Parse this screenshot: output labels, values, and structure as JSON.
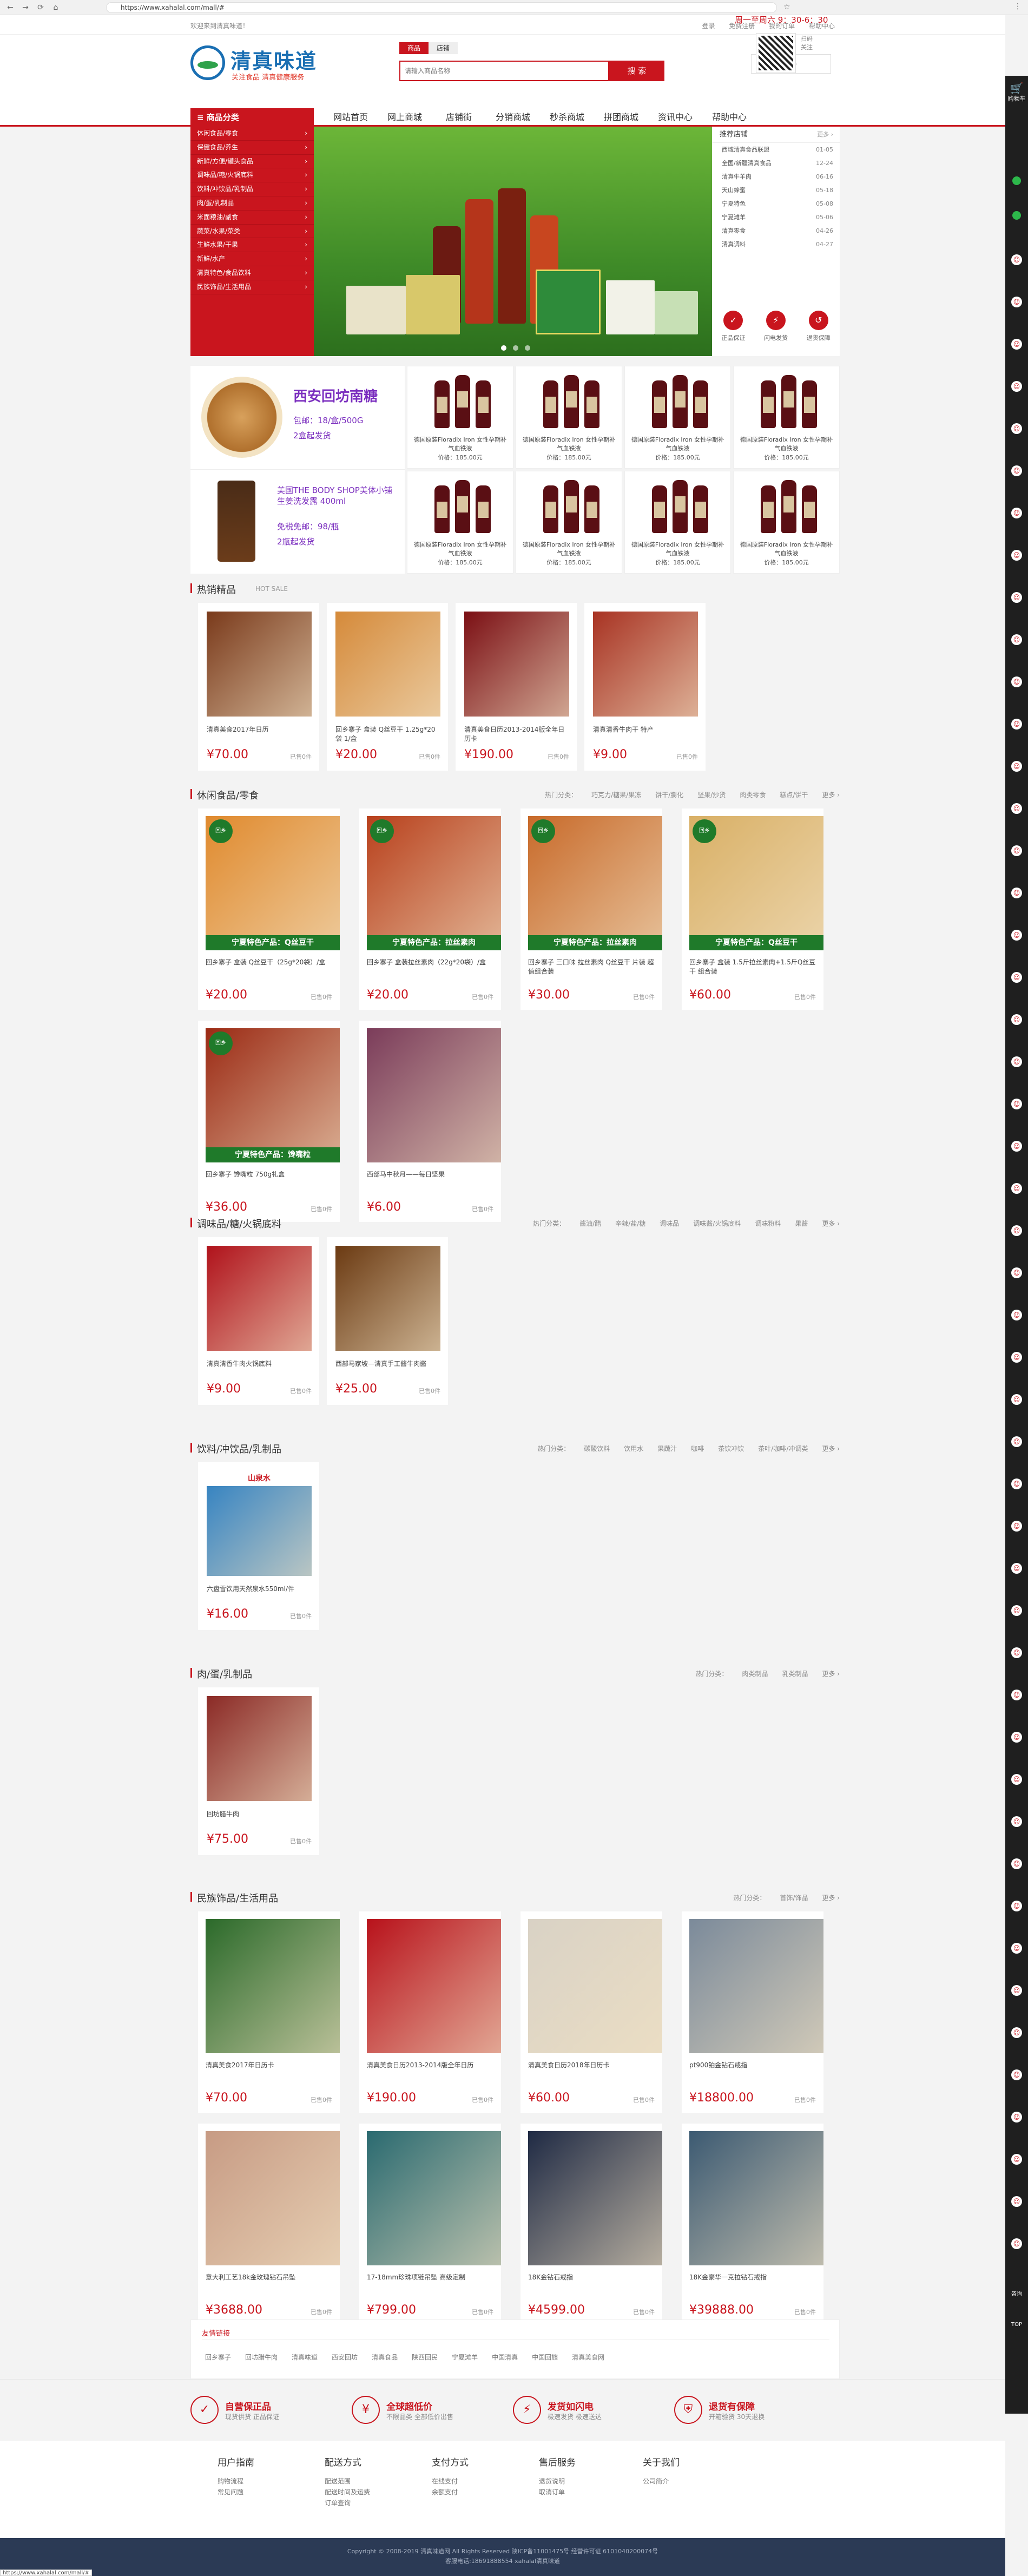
{
  "browser": {
    "url": "https://www.xahalal.com/mall/#",
    "back": "←",
    "forward": "→",
    "reload": "⟳",
    "home": "⌂",
    "star": "☆",
    "menu": "⋮"
  },
  "topbar": {
    "welcome": "欢迎来到清真味道！",
    "links": [
      "登录",
      "免费注册",
      "我的订单",
      "帮助中心"
    ]
  },
  "logo": {
    "title": "清真味道",
    "sub": "关注食品 清真健康服务"
  },
  "search": {
    "tabs": [
      "商品",
      "店铺"
    ],
    "placeholder": "请输入商品名称",
    "button": "搜 索"
  },
  "cart": {
    "label": "购物车 0 件 ›"
  },
  "nav": {
    "category_head": "≡ 商品分类",
    "links": [
      "网站首页",
      "网上商城",
      "店铺街",
      "分销商城",
      "秒杀商城",
      "拼团商城",
      "资讯中心",
      "帮助中心"
    ]
  },
  "categories": [
    "休闲食品/零食",
    "保健食品/养生",
    "新鲜/方便/罐头食品",
    "调味品/糖/火锅底料",
    "饮料/冲饮品/乳制品",
    "肉/蛋/乳制品",
    "米面粮油/副食",
    "蔬菜/水果/菜类",
    "生鲜水果/干果",
    "新鲜/水产",
    "清真特色/食品饮料",
    "民族饰品/生活用品"
  ],
  "news": {
    "head": "推荐店铺",
    "more": "更多 ›",
    "items": [
      {
        "t": "西域清真食品联盟",
        "d": "01-05"
      },
      {
        "t": "全国/新疆清真食品",
        "d": "12-24"
      },
      {
        "t": "清真牛羊肉",
        "d": "06-16"
      },
      {
        "t": "天山蜂蜜",
        "d": "05-18"
      },
      {
        "t": "宁夏特色",
        "d": "05-08"
      },
      {
        "t": "宁夏滩羊",
        "d": "05-06"
      },
      {
        "t": "清真零食",
        "d": "04-26"
      },
      {
        "t": "清真调料",
        "d": "04-27"
      }
    ]
  },
  "promises": [
    {
      "icon": "✓",
      "label": "正品保证"
    },
    {
      "icon": "⚡",
      "label": "闪电发货"
    },
    {
      "icon": "↺",
      "label": "退货保障"
    }
  ],
  "promo": {
    "p1": {
      "title": "西安回坊南糖",
      "line1": "包邮：18/盒/500G",
      "line2": "2盒起发货"
    },
    "p2": {
      "title": "美国THE BODY SHOP美体小铺生姜洗发露 400ml",
      "line1": "免税免邮：98/瓶",
      "line2": "2瓶起发货"
    }
  },
  "grid8": {
    "name": "德国原装Floradix Iron 女性孕期补气血铁液",
    "price": "价格：185.00元"
  },
  "sections": {
    "hot": {
      "title": "热销精品",
      "en": "HOT SALE",
      "items": [
        {
          "name": "清真美食2017年日历",
          "price": "¥70.00",
          "sold": "已售0件"
        },
        {
          "name": "回乡寨子 盒装 Q丝豆干 1.25g*20袋 1/盒",
          "price": "¥20.00",
          "sold": "已售0件"
        },
        {
          "name": "清真美食日历2013-2014版全年日历卡",
          "price": "¥190.00",
          "sold": "已售0件"
        },
        {
          "name": "清真清香牛肉干 特产",
          "price": "¥9.00",
          "sold": "已售0件"
        }
      ]
    },
    "snack": {
      "title": "休闲食品/零食",
      "links": [
        "热门分类：",
        "巧克力/糖果/果冻",
        "饼干/膨化",
        "坚果/炒货",
        "肉类零食",
        "糕点/饼干",
        "更多 ›"
      ],
      "items": [
        {
          "name": "回乡寨子 盒装 Q丝豆干（25g*20袋）/盒",
          "price": "¥20.00",
          "sold": "已售0件",
          "band": "宁夏特色产品：Q丝豆干"
        },
        {
          "name": "回乡寨子 盒装拉丝素肉（22g*20袋）/盒",
          "price": "¥20.00",
          "sold": "已售0件",
          "band": "宁夏特色产品：拉丝素肉"
        },
        {
          "name": "回乡寨子 三口味 拉丝素肉 Q丝豆干 片装 超值组合装",
          "price": "¥30.00",
          "sold": "已售0件",
          "band": "宁夏特色产品：拉丝素肉"
        },
        {
          "name": "回乡寨子 盒装 1.5斤拉丝素肉+1.5斤Q丝豆干 组合装",
          "price": "¥60.00",
          "sold": "已售0件",
          "band": "宁夏特色产品：Q丝豆干"
        },
        {
          "name": "回乡寨子 馋嘴粒 750g礼盒",
          "price": "¥36.00",
          "sold": "已售0件",
          "band": "宁夏特色产品：馋嘴粒"
        },
        {
          "name": "西部马中秋月——每日坚果",
          "price": "¥6.00",
          "sold": "已售0件"
        }
      ]
    },
    "season": {
      "title": "调味品/糖/火锅底料",
      "links": [
        "热门分类：",
        "酱油/醋",
        "辛辣/盐/糖",
        "调味品",
        "调味酱/火锅底料",
        "调味粉料",
        "果酱",
        "更多 ›"
      ],
      "items": [
        {
          "name": "清真清香牛肉火锅底料",
          "price": "¥9.00",
          "sold": "已售0件"
        },
        {
          "name": "西部马家坡—清真手工酱牛肉酱",
          "price": "¥25.00",
          "sold": "已售0件"
        }
      ]
    },
    "drink": {
      "title": "饮料/冲饮品/乳制品",
      "links": [
        "热门分类：",
        "碳酸饮料",
        "饮用水",
        "果蔬汁",
        "咖啡",
        "茶饮冲饮",
        "茶叶/咖啡/冲调类",
        "更多 ›"
      ],
      "items": [
        {
          "name": "六盘雪饮用天然泉水550ml/件",
          "price": "¥16.00",
          "sold": "已售0件",
          "label": "山泉水"
        }
      ]
    },
    "meat": {
      "title": "肉/蛋/乳制品",
      "links": [
        "热门分类：",
        "肉类制品",
        "乳类制品",
        "更多 ›"
      ],
      "items": [
        {
          "name": "回坊腊牛肉",
          "price": "¥75.00",
          "sold": "已售0件"
        }
      ]
    },
    "ethnic": {
      "title": "民族饰品/生活用品",
      "links": [
        "热门分类：",
        "首饰/饰品",
        "更多 ›"
      ],
      "items": [
        {
          "name": "清真美食2017年日历卡",
          "price": "¥70.00",
          "sold": "已售0件"
        },
        {
          "name": "清真美食日历2013-2014版全年日历",
          "price": "¥190.00",
          "sold": "已售0件"
        },
        {
          "name": "清真美食日历2018年日历卡",
          "price": "¥60.00",
          "sold": "已售0件"
        },
        {
          "name": "pt900铂金钻石戒指",
          "price": "¥18800.00",
          "sold": "已售0件"
        },
        {
          "name": "意大利工艺18k金玫瑰钻石吊坠",
          "price": "¥3688.00",
          "sold": "已售0件"
        },
        {
          "name": "17-18mm珍珠项链吊坠 高级定制",
          "price": "¥799.00",
          "sold": "已售0件"
        },
        {
          "name": "18K金钻石戒指",
          "price": "¥4599.00",
          "sold": "已售0件"
        },
        {
          "name": "18K金豪华一克拉钻石戒指",
          "price": "¥39888.00",
          "sold": "已售0件"
        }
      ]
    }
  },
  "calendar": {
    "label": "清真美食"
  },
  "friend": {
    "title": "友情链接",
    "items": [
      "回乡寨子",
      "回坊腊牛肉",
      "清真味道",
      "西安回坊",
      "清真食品",
      "陕西回民",
      "宁夏滩羊",
      "中国清真",
      "中国回族",
      "清真美食网"
    ]
  },
  "services": [
    {
      "icon": "✓",
      "a": "自营保正品",
      "b": "现货供货 正品保证"
    },
    {
      "icon": "¥",
      "a": "全球超低价",
      "b": "不限品类 全部低价出售"
    },
    {
      "icon": "⚡",
      "a": "发货如闪电",
      "b": "极速发货 极速送达"
    },
    {
      "icon": "⛨",
      "a": "退货有保障",
      "b": "开箱验货 30天退换"
    }
  ],
  "help": [
    {
      "h": "用户指南",
      "i": [
        "购物流程",
        "常见问题"
      ]
    },
    {
      "h": "配送方式",
      "i": [
        "配送范围",
        "配送时间及运费",
        "订单查询"
      ]
    },
    {
      "h": "支付方式",
      "i": [
        "在线支付",
        "余额支付"
      ]
    },
    {
      "h": "售后服务",
      "i": [
        "退货说明",
        "取消订单"
      ]
    },
    {
      "h": "关于我们",
      "i": [
        "公司简介"
      ]
    }
  ],
  "hotline": "周一至周六 9：30-6：30",
  "qr_text": "扫码关注",
  "footer": {
    "line1": "Copyright © 2008-2019 清真味道网 All Rights Reserved 陕ICP备11001475号 经营许可证 6101040200074号",
    "line2": "客服电话:18691888554  xahalal清真味道"
  },
  "status_url": "https://www.xahalal.com/mall/#",
  "sidebar": {
    "cart": "购物车",
    "service": "咨询",
    "top": "TOP"
  },
  "colors": {
    "brand": "#c9151e",
    "logo": "#1a6fb3",
    "footer": "#2b3a55"
  }
}
